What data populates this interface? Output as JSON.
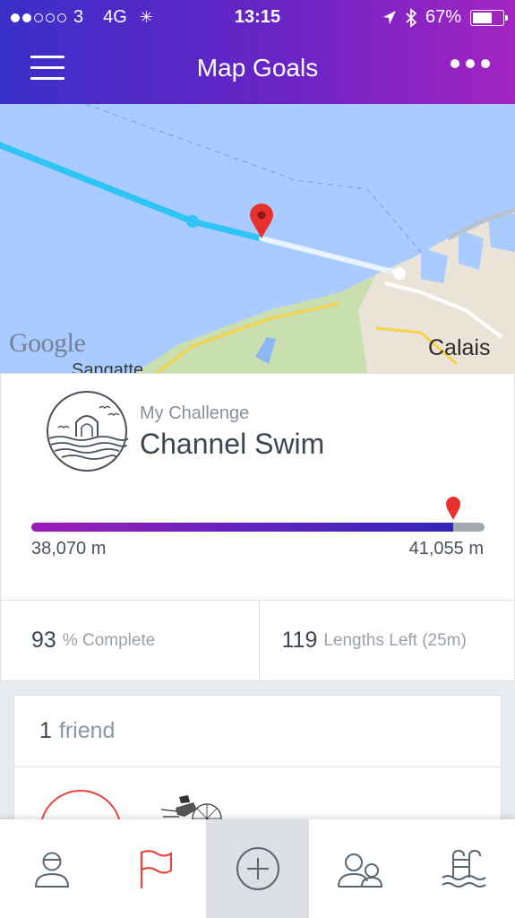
{
  "status_bar": {
    "carrier": "3",
    "network": "4G",
    "time": "13:15",
    "battery": "67%",
    "battery_level": 0.67
  },
  "header": {
    "title": "Map Goals",
    "menu_icon": "hamburger-menu-icon",
    "more_icon": "more-options-icon"
  },
  "map": {
    "attribution": "Google",
    "labels": {
      "calais": "Calais",
      "sangatte": "Sangatte"
    }
  },
  "challenge": {
    "subtitle": "My Challenge",
    "name": "Channel Swim",
    "distance_done": "38,070 m",
    "distance_total": "41,055 m",
    "progress": 0.93,
    "percent_value": "93",
    "percent_label": "% Complete",
    "lengths_value": "119",
    "lengths_label": "Lengths Left (25m)"
  },
  "friends": {
    "count": "1",
    "label": "friend"
  },
  "colors": {
    "header_start": "#3a2fc9",
    "header_end": "#a424c2",
    "route": "#2fc4f5",
    "pin": "#e8302d"
  },
  "tabs": [
    {
      "name": "profile",
      "icon": "person-icon"
    },
    {
      "name": "goals",
      "icon": "flag-icon",
      "active": true
    },
    {
      "name": "add",
      "icon": "plus-circle-icon"
    },
    {
      "name": "friends",
      "icon": "friends-icon"
    },
    {
      "name": "pool",
      "icon": "pool-ladder-icon"
    }
  ]
}
